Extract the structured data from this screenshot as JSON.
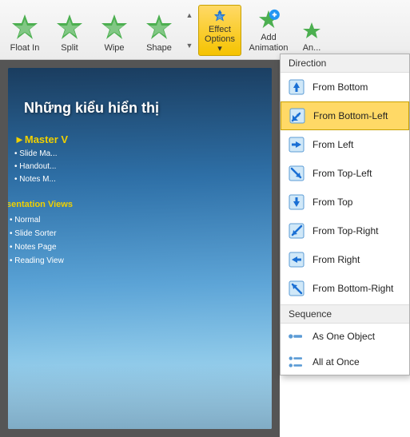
{
  "ribbon": {
    "buttons": [
      {
        "id": "float-in",
        "label": "Float In"
      },
      {
        "id": "split",
        "label": "Split"
      },
      {
        "id": "wipe",
        "label": "Wipe"
      },
      {
        "id": "shape",
        "label": "Shape"
      }
    ],
    "effect_options_label": "Effect\nOptions",
    "effect_options_arrow": "▾",
    "add_animation_label": "Add\nAnimation",
    "animation_label": "An..."
  },
  "slide": {
    "title": "Những kiểu hiển thị",
    "master_label": "►Master V",
    "list_items": [
      "• Slide Ma...",
      "• Handout...",
      "• Notes M..."
    ],
    "section_label": "sentation Views",
    "items": [
      "• Normal",
      "• Slide Sorter",
      "• Notes Page",
      "• Reading View"
    ]
  },
  "dropdown": {
    "direction_label": "Direction",
    "items": [
      {
        "id": "from-bottom",
        "label": "From Bottom",
        "active": false
      },
      {
        "id": "from-bottom-left",
        "label": "From Bottom-Left",
        "active": true
      },
      {
        "id": "from-left",
        "label": "From Left",
        "active": false
      },
      {
        "id": "from-top-left",
        "label": "From Top-Left",
        "active": false
      },
      {
        "id": "from-top",
        "label": "From Top",
        "active": false
      },
      {
        "id": "from-top-right",
        "label": "From Top-Right",
        "active": false
      },
      {
        "id": "from-right",
        "label": "From Right",
        "active": false
      },
      {
        "id": "from-bottom-right",
        "label": "From Bottom-Right",
        "active": false
      }
    ],
    "sequence_label": "Sequence",
    "sequence_items": [
      {
        "id": "as-one-object",
        "label": "As One Object"
      },
      {
        "id": "all-at-once",
        "label": "All at Once"
      }
    ]
  }
}
